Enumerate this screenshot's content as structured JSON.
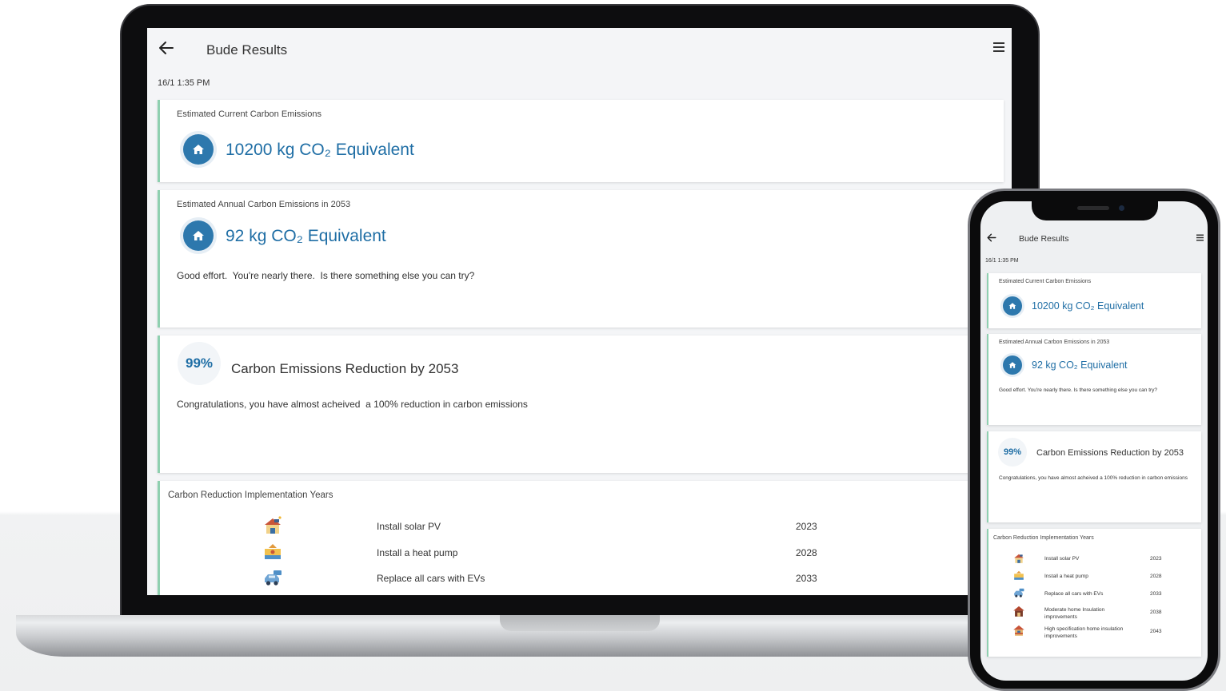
{
  "app": {
    "title": "Bude Results",
    "timestamp": "16/1 1:35 PM"
  },
  "current_emissions": {
    "label": "Estimated Current Carbon Emissions",
    "value": "10200 kg CO₂ Equivalent",
    "icon": "house-icon"
  },
  "annual_emissions": {
    "label": "Estimated Annual Carbon Emissions in 2053",
    "value": "92 kg CO₂ Equivalent",
    "icon": "house-icon",
    "message": "Good effort.  You're nearly there.  Is there something else you can try?"
  },
  "reduction": {
    "percent": "99%",
    "title": "Carbon Emissions Reduction by 2053",
    "message": "Congratulations, you have almost acheived  a 100% reduction in carbon emissions"
  },
  "implementation": {
    "title": "Carbon Reduction Implementation Years",
    "rows": [
      {
        "action": "Install solar PV",
        "year": "2023",
        "icon": "solar-house-icon"
      },
      {
        "action": "Install a heat pump",
        "year": "2028",
        "icon": "heat-pump-icon"
      },
      {
        "action": "Replace all cars with EVs",
        "year": "2033",
        "icon": "ev-car-icon"
      },
      {
        "action": "Moderate home Insulation improvements",
        "year": "2038",
        "icon": "insulated-house-icon"
      },
      {
        "action": "High specification home insulation improvements",
        "year": "2043",
        "icon": "high-spec-house-icon"
      }
    ]
  },
  "colors": {
    "accent_blue": "#1f6ea5",
    "icon_blue": "#2d78ad",
    "card_border": "#8fd0b0",
    "background": "#f4f5f7"
  }
}
